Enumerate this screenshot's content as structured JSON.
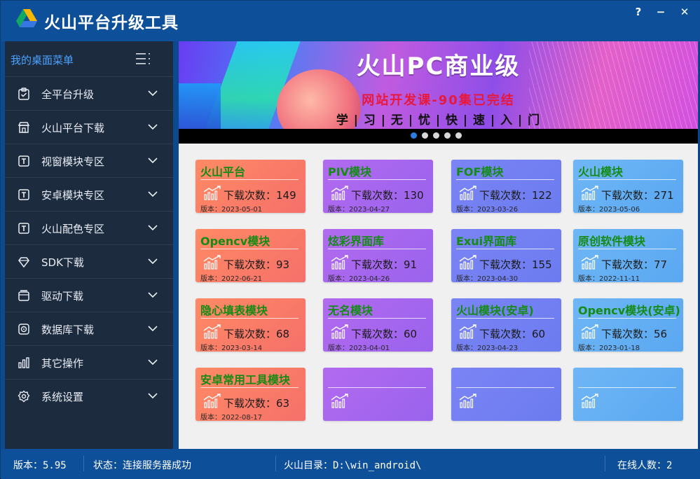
{
  "app": {
    "title": "火山平台升级工具",
    "controls": {
      "help": "?",
      "minimize": "−",
      "close": "✕"
    }
  },
  "sidebar": {
    "title": "我的桌面菜单",
    "items": [
      {
        "label": "全平台升级",
        "icon": "clipboard-check-icon"
      },
      {
        "label": "火山平台下载",
        "icon": "store-icon"
      },
      {
        "label": "视窗模块专区",
        "icon": "text-box-icon"
      },
      {
        "label": "安卓模块专区",
        "icon": "text-box-icon"
      },
      {
        "label": "火山配色专区",
        "icon": "text-box-icon"
      },
      {
        "label": "SDK下载",
        "icon": "diamond-icon"
      },
      {
        "label": "驱动下载",
        "icon": "package-icon"
      },
      {
        "label": "数据库下载",
        "icon": "database-icon"
      },
      {
        "label": "其它操作",
        "icon": "bar-chart-icon"
      },
      {
        "label": "系统设置",
        "icon": "gear-icon"
      }
    ]
  },
  "banner": {
    "title": "火山PC商业级",
    "subtitle": "网站开发课-90集已完结",
    "tagline": "学 | 习 | 无 | 忧 | 快 | 速 | 入 | 门",
    "slides": 5,
    "active_slide": 1
  },
  "cards": [
    {
      "title": "火山平台",
      "count": "下载次数：149",
      "version": "版本：2023-05-01",
      "color": "orange"
    },
    {
      "title": "PIV模块",
      "count": "下载次数：130",
      "version": "版本：2023-04-27",
      "color": "purple"
    },
    {
      "title": "FOF模块",
      "count": "下载次数：122",
      "version": "版本：2023-03-26",
      "color": "indigo"
    },
    {
      "title": "火山模块",
      "count": "下载次数：271",
      "version": "版本：2023-05-06",
      "color": "blue"
    },
    {
      "title": "Opencv模块",
      "count": "下载次数：93",
      "version": "版本：2022-06-21",
      "color": "orange"
    },
    {
      "title": "炫彩界面库",
      "count": "下载次数：91",
      "version": "版本：2023-04-26",
      "color": "purple"
    },
    {
      "title": "Exui界面库",
      "count": "下载次数：155",
      "version": "版本：2023-04-30",
      "color": "indigo"
    },
    {
      "title": "原创软件模块",
      "count": "下载次数：77",
      "version": "版本：2022-11-11",
      "color": "blue"
    },
    {
      "title": "隐心填表模块",
      "count": "下载次数：68",
      "version": "版本：2023-03-14",
      "color": "orange"
    },
    {
      "title": "无名模块",
      "count": "下载次数：60",
      "version": "版本：2023-04-01",
      "color": "purple"
    },
    {
      "title": "火山模块(安卓)",
      "count": "下载次数：60",
      "version": "版本：2023-04-23",
      "color": "indigo"
    },
    {
      "title": "Opencv模块(安卓)",
      "count": "下载次数：56",
      "version": "版本：2023-01-18",
      "color": "blue"
    },
    {
      "title": "安卓常用工具模块",
      "count": "下载次数：63",
      "version": "版本：2022-08-17",
      "color": "orange"
    },
    {
      "title": "",
      "count": "",
      "version": "",
      "color": "purple"
    },
    {
      "title": "",
      "count": "",
      "version": "",
      "color": "indigo"
    },
    {
      "title": "",
      "count": "",
      "version": "",
      "color": "blue"
    }
  ],
  "statusbar": {
    "version": "版本：5.95",
    "state": "状态：连接服务器成功",
    "directory": "火山目录：D:\\win_android\\",
    "online": "在线人数：2"
  },
  "colors": {
    "titlebar": "#0d4f98",
    "sidebar": "#1d2b3f",
    "card_title": "#148c14",
    "sidebar_title": "#4ba3ff"
  }
}
